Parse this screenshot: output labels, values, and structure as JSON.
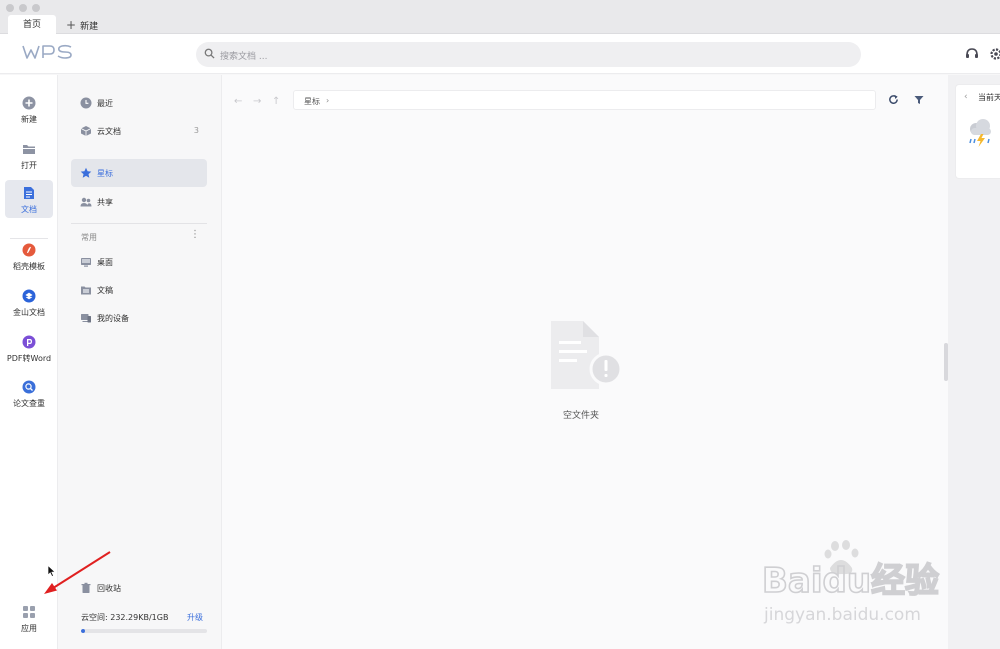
{
  "tabs": {
    "home": "首页",
    "new": "新建"
  },
  "search": {
    "placeholder": "搜索文档 ..."
  },
  "leftnav": [
    {
      "name": "new",
      "label": "新建",
      "icon": "plus-circle-icon"
    },
    {
      "name": "open",
      "label": "打开",
      "icon": "folder-icon"
    },
    {
      "name": "docs",
      "label": "文档",
      "icon": "document-icon",
      "active": true
    },
    {
      "name": "daoke",
      "label": "稻壳模板",
      "icon": "daoke-icon"
    },
    {
      "name": "kdocs",
      "label": "金山文档",
      "icon": "kdocs-icon"
    },
    {
      "name": "pdf2word",
      "label": "PDF转Word",
      "icon": "pdf-icon"
    },
    {
      "name": "paper-check",
      "label": "论文查重",
      "icon": "paper-check-icon"
    },
    {
      "name": "apps",
      "label": "应用",
      "icon": "apps-grid-icon"
    }
  ],
  "midnav": {
    "recent": "最近",
    "cloud": "云文档",
    "cloud_count": "3",
    "starred": "星标",
    "shared": "共享",
    "section_common": "常用",
    "section_more": "⋮",
    "desktop": "桌面",
    "drafts": "文稿",
    "my_devices": "我的设备",
    "recycle": "回收站",
    "cloud_space": "云空间: 232.29KB/1GB",
    "upgrade": "升级",
    "usage_fraction": 0.02
  },
  "main": {
    "breadcrumb": "星标",
    "empty_text": "空文件夹"
  },
  "right": {
    "label": "当前天"
  },
  "watermark": {
    "brand": "Baidu经验",
    "url": "jingyan.baidu.com"
  },
  "colors": {
    "accent": "#3b6fdc",
    "annotation": "#e02020"
  }
}
